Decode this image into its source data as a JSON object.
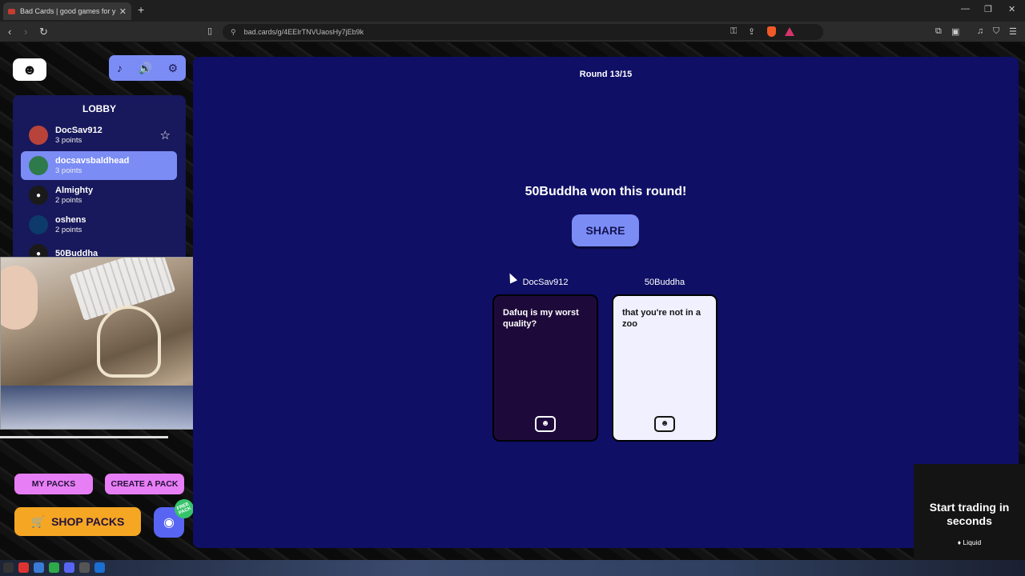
{
  "browser": {
    "tab_title": "Bad Cards | good games for y",
    "new_tab": "+",
    "close": "✕",
    "url": "bad.cards/g/4EEIrTNVUaosHy7jEb9k",
    "back": "‹",
    "forward": "›",
    "reload": "↻",
    "minimize": "—",
    "maximize": "❐",
    "window_close": "✕"
  },
  "sidebar": {
    "logo": "☻",
    "controls": {
      "music": "♪",
      "volume": "🔊",
      "settings": "⚙"
    },
    "lobby_title": "LOBBY",
    "players": [
      {
        "name": "DocSav912",
        "points": "3 points",
        "avatar_color": "#b8433a"
      },
      {
        "name": "docsavsbaldhead",
        "points": "3 points",
        "avatar_color": "#2e7a4a"
      },
      {
        "name": "Almighty",
        "points": "2 points",
        "avatar_color": "#1a1a1a"
      },
      {
        "name": "oshens",
        "points": "2 points",
        "avatar_color": "#0c3a6a"
      },
      {
        "name": "50Buddha",
        "points": "",
        "avatar_color": "#1a1a1a"
      }
    ],
    "host_star": "☆",
    "my_packs": "MY PACKS",
    "create_pack": "CREATE A PACK",
    "shop_packs": "SHOP PACKS",
    "cart_icon": "🛒",
    "discord_icon": "◉",
    "free_badge": "FREE PACK"
  },
  "game": {
    "round": "Round 13/15",
    "winner_text": "50Buddha won this round!",
    "share": "SHARE",
    "cards": [
      {
        "owner": "DocSav912",
        "text": "Dafuq is my worst quality?",
        "kind": "black"
      },
      {
        "owner": "50Buddha",
        "text": "that you're not in a zoo",
        "kind": "white"
      }
    ]
  },
  "ad": {
    "headline": "Start trading in seconds",
    "brand": "♦ Liquid"
  }
}
